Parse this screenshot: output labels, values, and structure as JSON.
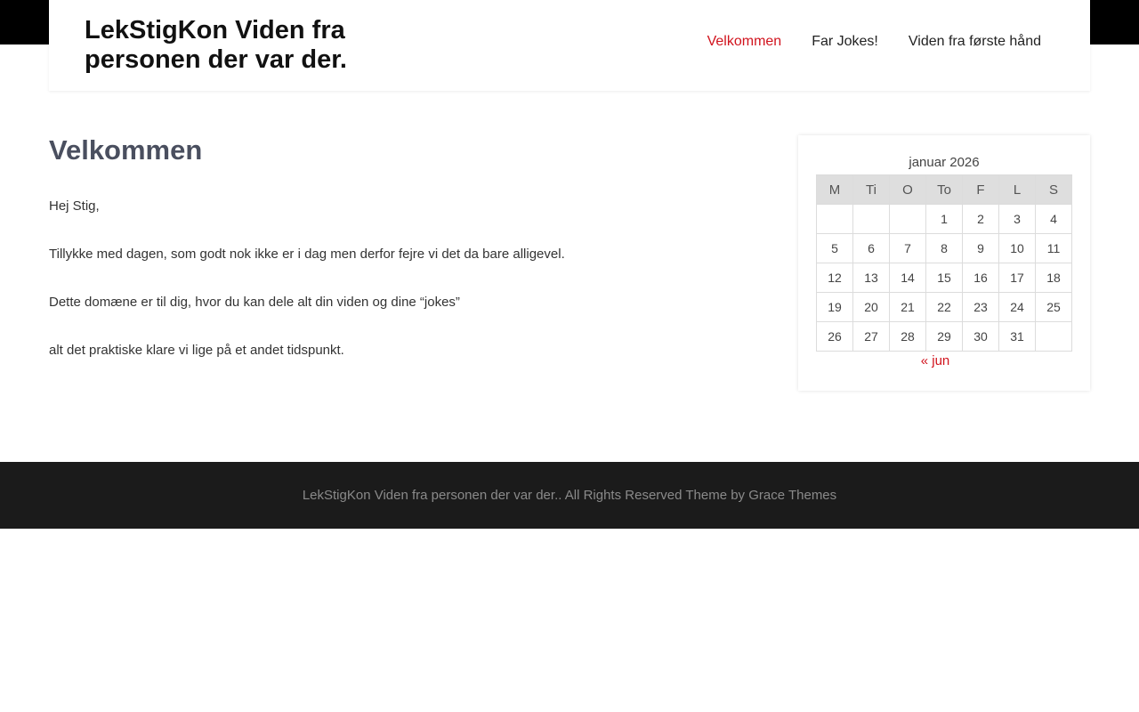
{
  "site": {
    "title": "LekStigKon Viden fra personen der var der."
  },
  "nav": {
    "items": [
      {
        "label": "Velkommen",
        "active": true
      },
      {
        "label": "Far Jokes!",
        "active": false
      },
      {
        "label": "Viden fra første hånd",
        "active": false
      }
    ]
  },
  "main": {
    "title": "Velkommen",
    "paragraphs": [
      "Hej Stig,",
      "Tillykke med dagen, som godt nok ikke er i dag men derfor fejre vi det da bare alligevel.",
      "Dette domæne er til dig, hvor du kan dele alt din viden og dine “jokes”",
      "alt det praktiske klare vi lige på et andet tidspunkt."
    ]
  },
  "calendar": {
    "caption": "januar 2026",
    "weekdays": [
      "M",
      "Ti",
      "O",
      "To",
      "F",
      "L",
      "S"
    ],
    "weeks": [
      [
        "",
        "",
        "",
        "1",
        "2",
        "3",
        "4"
      ],
      [
        "5",
        "6",
        "7",
        "8",
        "9",
        "10",
        "11"
      ],
      [
        "12",
        "13",
        "14",
        "15",
        "16",
        "17",
        "18"
      ],
      [
        "19",
        "20",
        "21",
        "22",
        "23",
        "24",
        "25"
      ],
      [
        "26",
        "27",
        "28",
        "29",
        "30",
        "31",
        ""
      ]
    ],
    "prev_link": "« jun"
  },
  "footer": {
    "text": "LekStigKon Viden fra personen der var der.. All Rights Reserved Theme by Grace Themes"
  }
}
